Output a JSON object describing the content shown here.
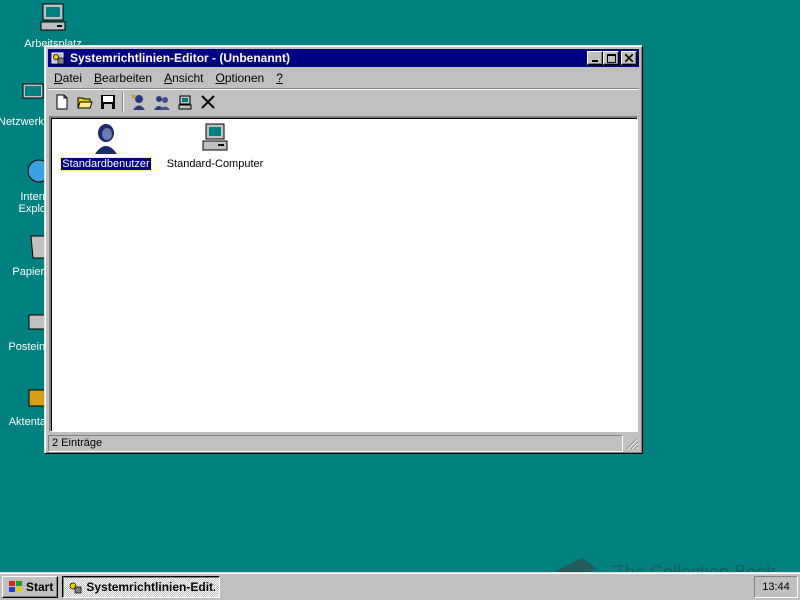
{
  "desktop": {
    "icons": [
      {
        "label": "Arbeitsplatz",
        "icon": "computer-icon"
      },
      {
        "label": "Netzwerkumgebung",
        "icon": "network-icon"
      },
      {
        "label": "Internet Explorer",
        "icon": "globe-icon"
      },
      {
        "label": "Papierkorb",
        "icon": "recycle-bin-icon"
      },
      {
        "label": "Posteingang",
        "icon": "inbox-icon"
      },
      {
        "label": "Aktentasche",
        "icon": "briefcase-icon"
      }
    ]
  },
  "window": {
    "title": "Systemrichtlinien-Editor - (Unbenannt)",
    "menu": [
      {
        "label": "Datei",
        "accel": "D"
      },
      {
        "label": "Bearbeiten",
        "accel": "B"
      },
      {
        "label": "Ansicht",
        "accel": "A"
      },
      {
        "label": "Optionen",
        "accel": "O"
      },
      {
        "label": "?",
        "accel": "?"
      }
    ],
    "toolbar": [
      "new-file-icon",
      "open-folder-icon",
      "save-icon",
      "add-user-icon",
      "add-group-icon",
      "add-computer-icon",
      "delete-icon"
    ],
    "items": [
      {
        "label": "Standardbenutzer",
        "icon": "user-icon",
        "selected": true
      },
      {
        "label": "Standard-Computer",
        "icon": "computer-icon",
        "selected": false
      }
    ],
    "status": "2 Einträge"
  },
  "taskbar": {
    "start_label": "Start",
    "task_label": "Systemrichtlinien-Edit...",
    "clock": "13:44"
  },
  "watermark": {
    "text": "The Collection Book"
  },
  "colors": {
    "desktop": "#008080",
    "titlebar": "#000080",
    "face": "#c0c0c0",
    "selection": "#000080"
  }
}
